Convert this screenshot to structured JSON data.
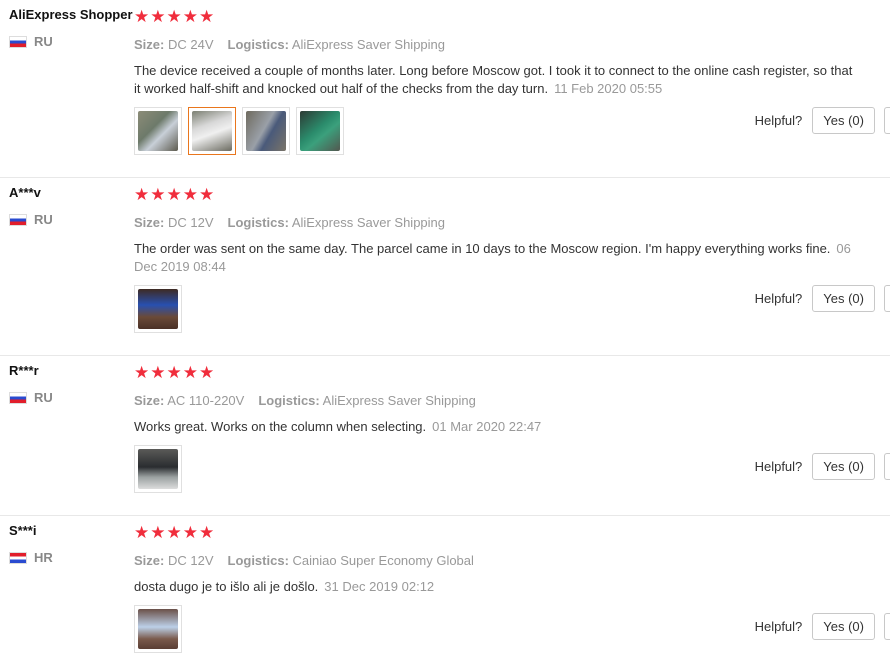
{
  "accent": {
    "star": "#f02d3c",
    "thumb_active": "#e9761d"
  },
  "labels": {
    "size": "Size:",
    "logistics": "Logistics:",
    "helpful": "Helpful?",
    "yes": "Yes (0)"
  },
  "reviews": [
    {
      "user": "AliExpress Shopper",
      "country": "RU",
      "flag": "flag-ru",
      "rating": 5,
      "size": "DC 24V",
      "logistics": "AliExpress Saver Shipping",
      "text": "The device received a couple of months later. Long before Moscow got. I took it to connect to the online cash register, so that it worked half-shift and knocked out half of the checks from the day turn.",
      "date": "11 Feb 2020 05:55",
      "photos": [
        "photo-device-hand",
        "photo-device-label",
        "photo-device-back",
        "photo-circuit-board"
      ]
    },
    {
      "user": "A***v",
      "country": "RU",
      "flag": "flag-ru",
      "rating": 5,
      "size": "DC 12V",
      "logistics": "AliExpress Saver Shipping",
      "text": "The order was sent on the same day. The parcel came in 10 days to the Moscow region. I'm happy everything works fine.",
      "date": "06 Dec 2019 08:44",
      "photos": [
        "photo-device-blue"
      ]
    },
    {
      "user": "R***r",
      "country": "RU",
      "flag": "flag-ru",
      "rating": 5,
      "size": "AC 110-220V",
      "logistics": "AliExpress Saver Shipping",
      "text": "Works great. Works on the column when selecting.",
      "date": "01 Mar 2020 22:47",
      "photos": [
        "photo-device-dark"
      ]
    },
    {
      "user": "S***i",
      "country": "HR",
      "flag": "flag-hr",
      "rating": 5,
      "size": "DC 12V",
      "logistics": "Cainiao Super Economy Global",
      "text": "dosta dugo je to išlo ali je došlo.",
      "date": "31 Dec 2019 02:12",
      "photos": [
        "photo-device-hand-light"
      ]
    }
  ]
}
